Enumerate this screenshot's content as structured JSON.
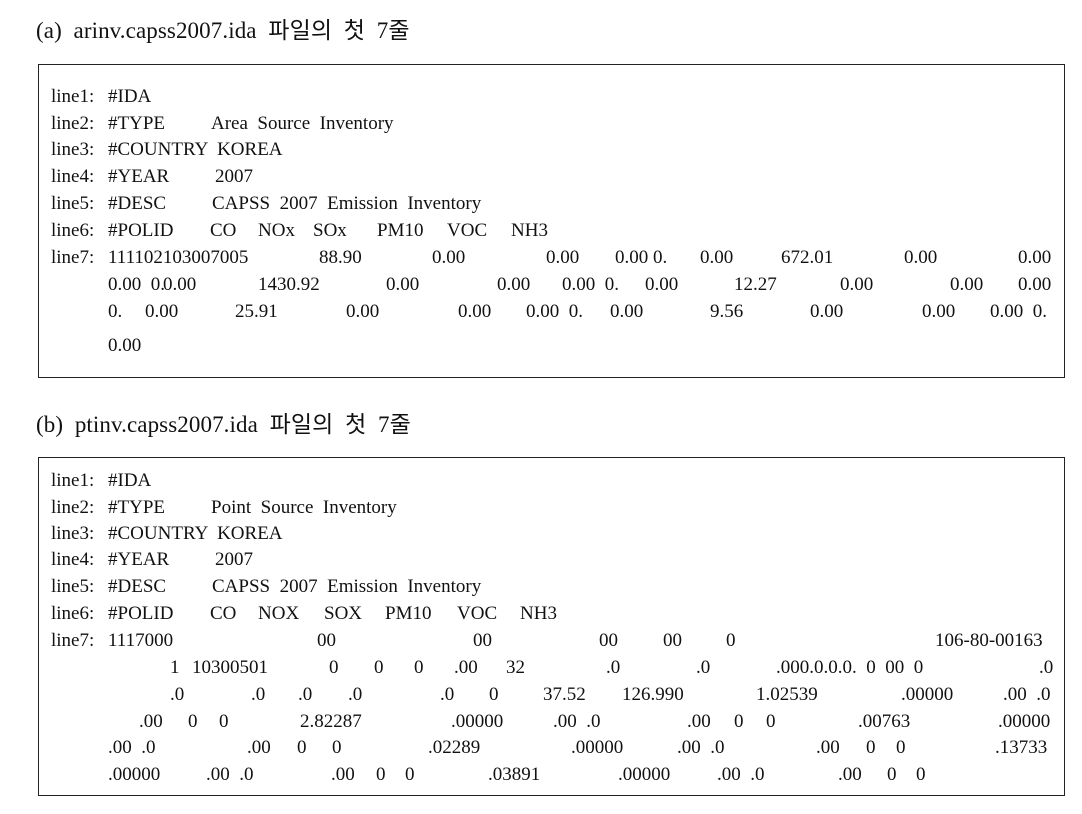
{
  "sections": [
    {
      "caption": "(a)  arinv.capss2007.ida  파일의  첫  7줄",
      "lines": [
        {
          "label": "line1:",
          "tokens": [
            "#IDA"
          ]
        },
        {
          "label": "line2:",
          "tokens": [
            "#TYPE",
            "Area  Source  Inventory"
          ]
        },
        {
          "label": "line3:",
          "tokens": [
            "#COUNTRY  KOREA"
          ]
        },
        {
          "label": "line4:",
          "tokens": [
            "#YEAR",
            "2007"
          ]
        },
        {
          "label": "line5:",
          "tokens": [
            "#DESC",
            "CAPSS  2007  Emission  Inventory"
          ]
        },
        {
          "label": "line6:",
          "tokens": [
            "#POLID",
            "CO",
            "NOx",
            "SOx",
            "PM10",
            "VOC",
            "NH3"
          ]
        },
        {
          "label": "line7:",
          "rows": [
            [
              "111102103007005",
              "88.90",
              "0.00",
              "0.00",
              "0.00 0.",
              "0.00",
              "672.01",
              "0.00",
              "0.00"
            ],
            [
              "0.00  0.",
              "0.00",
              "1430.92",
              "0.00",
              "0.00",
              "0.00  0.",
              "0.00",
              "12.27",
              "0.00",
              "0.00",
              "0.00"
            ],
            [
              "0.",
              "0.00",
              "25.91",
              "0.00",
              "0.00",
              "0.00  0.",
              "0.00",
              "9.56",
              "0.00",
              "0.00",
              "0.00  0."
            ],
            [
              "0.00"
            ]
          ]
        }
      ]
    },
    {
      "caption": "(b)  ptinv.capss2007.ida  파일의  첫  7줄",
      "lines": [
        {
          "label": "line1:",
          "tokens": [
            "#IDA"
          ]
        },
        {
          "label": "line2:",
          "tokens": [
            "#TYPE",
            "Point  Source  Inventory"
          ]
        },
        {
          "label": "line3:",
          "tokens": [
            "#COUNTRY  KOREA"
          ]
        },
        {
          "label": "line4:",
          "tokens": [
            "#YEAR",
            "2007"
          ]
        },
        {
          "label": "line5:",
          "tokens": [
            "#DESC",
            "CAPSS  2007  Emission  Inventory"
          ]
        },
        {
          "label": "line6:",
          "tokens": [
            "#POLID",
            "CO",
            "NOX",
            "SOX",
            "PM10",
            "VOC",
            "NH3"
          ]
        },
        {
          "label": "line7:",
          "rows": [
            [
              "1117000",
              "00",
              "00",
              "00",
              "00",
              "0",
              "106-80-00163"
            ],
            [
              "1",
              "10300501",
              "0",
              "0",
              "0",
              ".00",
              "32",
              ".0",
              ".0",
              ".000.0.0.0.  0  00  0",
              ".0"
            ],
            [
              ".0",
              ".0",
              ".0",
              ".0",
              ".0",
              "0",
              "37.52",
              "126.990",
              "1.02539",
              ".00000",
              ".00  .0"
            ],
            [
              ".00",
              "0",
              "0",
              "2.82287",
              ".00000",
              ".00  .0",
              ".00",
              "0",
              "0",
              ".00763",
              ".00000"
            ],
            [
              ".00  .0",
              ".00",
              "0",
              "0",
              ".02289",
              ".00000",
              ".00  .0",
              ".00",
              "0",
              "0",
              ".13733"
            ],
            [
              ".00000",
              ".00  .0",
              ".00",
              "0",
              "0",
              ".03891",
              ".00000",
              ".00  .0",
              ".00",
              "0",
              "0"
            ]
          ]
        }
      ]
    }
  ]
}
